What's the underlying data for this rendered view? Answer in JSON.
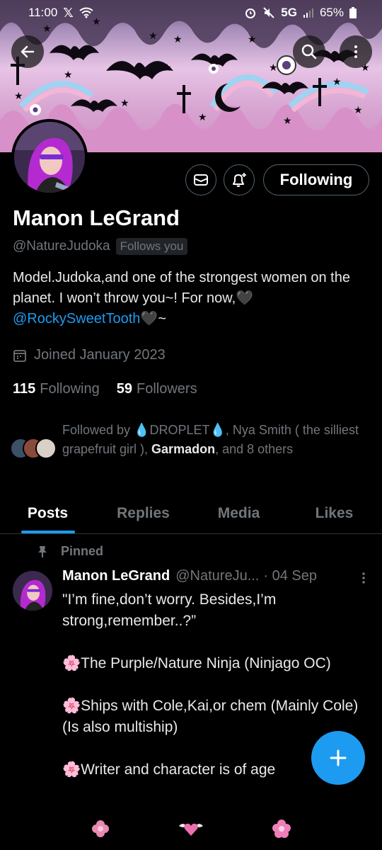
{
  "status_bar": {
    "time": "11:00",
    "network": "5G",
    "battery": "65%"
  },
  "profile": {
    "name": "Manon LeGrand",
    "handle": "@NatureJudoka",
    "follows_you_badge": "Follows you",
    "following_button": "Following",
    "bio_text": "Model.Judoka,and one of the strongest women on the planet. I won’t throw you~! For now,🖤",
    "bio_mention": "@RockySweetTooth",
    "bio_suffix": "🖤~",
    "joined": "Joined January 2023",
    "following_count": "115",
    "following_label": "Following",
    "followers_count": "59",
    "followers_label": "Followers",
    "followed_by_prefix": "Followed by 💧DROPLET💧, Nya Smith ( the silliest grapefruit girl ), ",
    "followed_by_bold": "Garmadon",
    "followed_by_suffix": ", and 8 others"
  },
  "tabs": [
    "Posts",
    "Replies",
    "Media",
    "Likes"
  ],
  "pinned_post": {
    "pinned_label": "Pinned",
    "author": "Manon LeGrand",
    "handle": "@NatureJu...",
    "date": "· 04 Sep",
    "paragraphs": [
      "\"I’m fine,don’t worry. Besides,I’m strong,remember..?”",
      "🌸The Purple/Nature Ninja (Ninjago OC)",
      "🌸Ships with Cole,Kai,or chem (Mainly Cole) (Is also multiship)",
      "🌸Writer and character is of age"
    ]
  },
  "icons": {
    "back": "back-arrow-icon",
    "search": "search-icon",
    "more": "more-vertical-icon",
    "message": "envelope-icon",
    "notify": "bell-plus-icon",
    "calendar": "calendar-icon",
    "pin": "pin-icon",
    "compose": "plus-icon"
  },
  "colors": {
    "accent": "#1d9bf0",
    "muted": "#71767b",
    "background": "#000000"
  }
}
